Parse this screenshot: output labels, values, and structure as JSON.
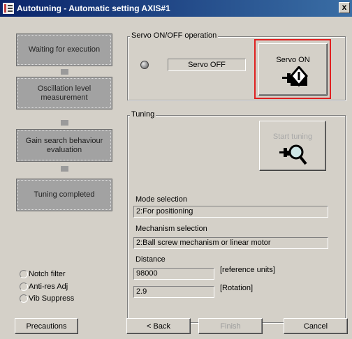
{
  "window": {
    "title": "Autotuning - Automatic setting AXIS#1",
    "close_glyph": "x"
  },
  "steps": [
    {
      "label": "Waiting for execution"
    },
    {
      "label": "Oscillation level measurement"
    },
    {
      "label": "Gain search behaviour evaluation"
    },
    {
      "label": "Tuning completed"
    }
  ],
  "servo_group": {
    "title": "Servo ON/OFF operation",
    "status": "Servo OFF",
    "button_label": "Servo ON",
    "highlight_color": "#e02020"
  },
  "tuning_group": {
    "title": "Tuning",
    "start_label": "Start tuning",
    "mode_label": "Mode selection",
    "mode_value": "2:For positioning",
    "mechanism_label": "Mechanism selection",
    "mechanism_value": "2:Ball screw mechanism or linear motor",
    "distance_label": "Distance",
    "distance_value": "98000",
    "distance_unit": "[reference units]",
    "rotation_value": "2.9",
    "rotation_unit": "[Rotation]"
  },
  "options": [
    {
      "label": "Notch filter"
    },
    {
      "label": "Anti-res Adj"
    },
    {
      "label": "Vib Suppress"
    }
  ],
  "footer": {
    "precautions": "Precautions",
    "back": "< Back",
    "finish": "Finish",
    "cancel": "Cancel"
  }
}
